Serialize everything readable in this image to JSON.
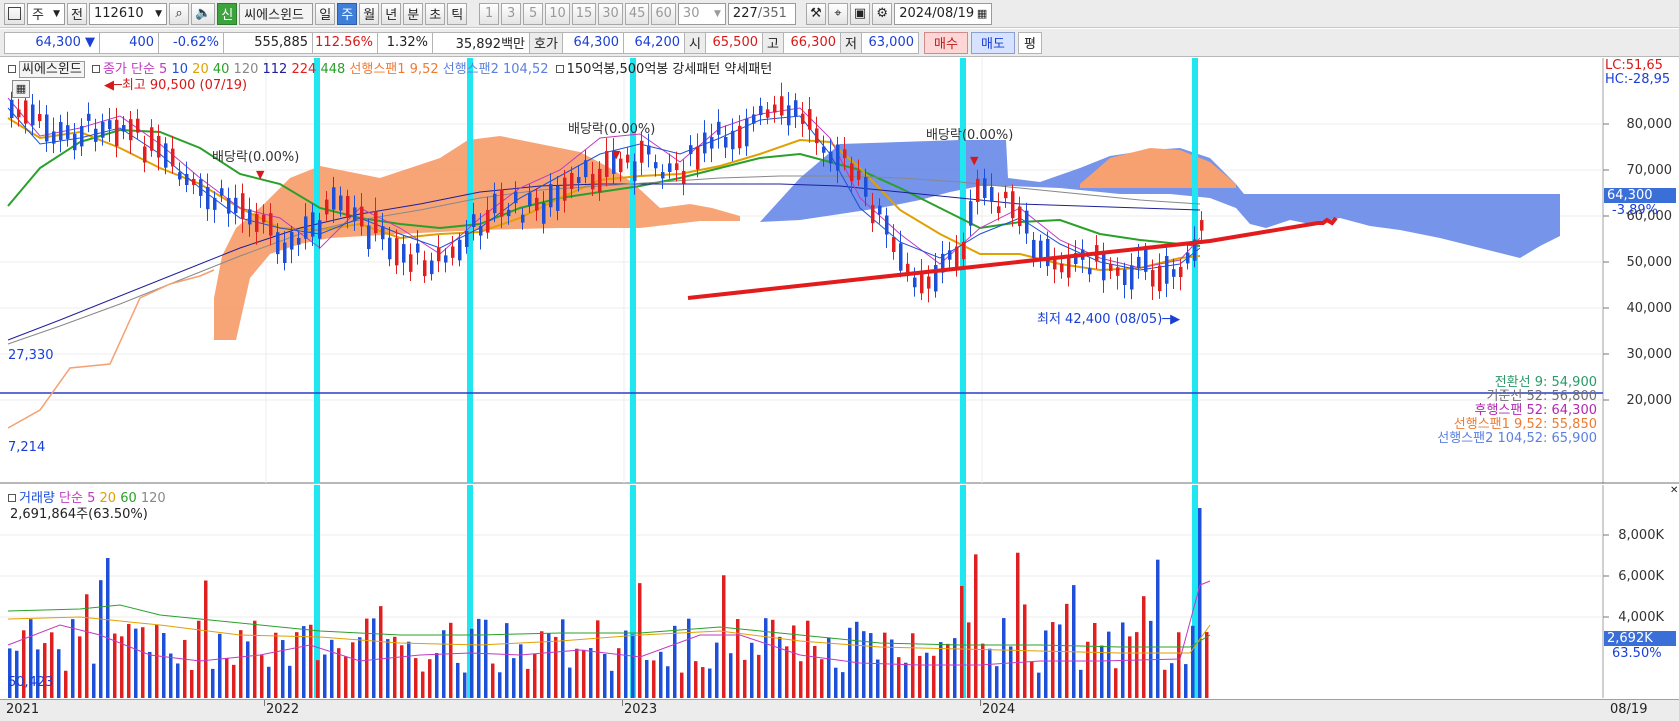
{
  "toolbar": {
    "chart_type_icon": "chart-icon",
    "period_select": "주",
    "market_select": "전",
    "code_value": "112610",
    "new_label": "신",
    "stock_name": "씨에스윈드",
    "periods": [
      "일",
      "주",
      "월",
      "년",
      "분",
      "초",
      "틱"
    ],
    "selected_period": "주",
    "intervals": [
      "1",
      "3",
      "5",
      "10",
      "15",
      "30",
      "45",
      "60"
    ],
    "interval_select": "30",
    "record_count": "227",
    "record_total": "/351",
    "date_value": "2024/08/19"
  },
  "quote": {
    "price": "64,300 ▼",
    "change": "400",
    "change_pct": "-0.62%",
    "volume": "555,885",
    "vol_ratio": "112.56%",
    "turnover": "1.32%",
    "amount": "35,892백만",
    "bid_ask_label": "호가",
    "ask": "64,300",
    "bid": "64,200",
    "open_label": "시",
    "open": "65,500",
    "high_label": "고",
    "high": "66,300",
    "low_label": "저",
    "low": "63,000",
    "buy_label": "매수",
    "sell_label": "매도",
    "eval_label": "평"
  },
  "price_pane": {
    "legend": {
      "name": "씨에스윈드",
      "close_ma": "종가 단순 5",
      "ma10": "10",
      "ma20": "20",
      "ma40": "40",
      "ma120": "120",
      "ma112": "112",
      "ma224": "224",
      "ma448": "448",
      "span1": "선행스팬1 9,52",
      "span2": "선행스팬2 104,52",
      "pattern": "150억봉,500억봉 강세패턴",
      "weak": "약세패턴"
    },
    "lc": "LC:51,65",
    "hc": "HC:-28,95",
    "high_note": "최고 90,500 (07/19)",
    "low_note": "최저 42,400 (08/05)",
    "dividends": [
      "배당락(0.00%)",
      "배당락(0.00%)",
      "배당락(0.00%)"
    ],
    "level_line": "27,330",
    "bottom_value": "7,214",
    "y_ticks": [
      "80,000",
      "70,000",
      "60,000",
      "50,000",
      "40,000",
      "30,000",
      "20,000"
    ],
    "price_tag": "64,300",
    "price_tag_pct": "-3.89%",
    "ichimoku": [
      {
        "label": "전환선 9: 54,900",
        "color": "#2a9a6a"
      },
      {
        "label": "기준선 52: 56,800",
        "color": "#707070"
      },
      {
        "label": "후행스팬 52: 64,300",
        "color": "#b02ab0"
      },
      {
        "label": "선행스팬1 9,52: 55,850",
        "color": "#f07a30"
      },
      {
        "label": "선행스팬2 104,52: 65,900",
        "color": "#5b7fe0"
      }
    ]
  },
  "volume_pane": {
    "legend_title": "거래량",
    "legend_ma": "단순 5",
    "ma20": "20",
    "ma60": "60",
    "ma120": "120",
    "info": "2,691,864주(63.50%)",
    "y_ticks": [
      "8,000K",
      "6,000K",
      "4,000K"
    ],
    "vol_tag": "2,692K",
    "vol_pct": "63.50%",
    "left_value": "50,423"
  },
  "x_axis": {
    "labels": [
      "2021",
      "2022",
      "2023",
      "2024"
    ],
    "end_label": "08/19"
  },
  "colors": {
    "up": "#e02020",
    "down": "#1d4fd8",
    "cyan": "#1fe6f0",
    "cloud_up": "#f7a070",
    "cloud_down": "#6688e8"
  }
}
